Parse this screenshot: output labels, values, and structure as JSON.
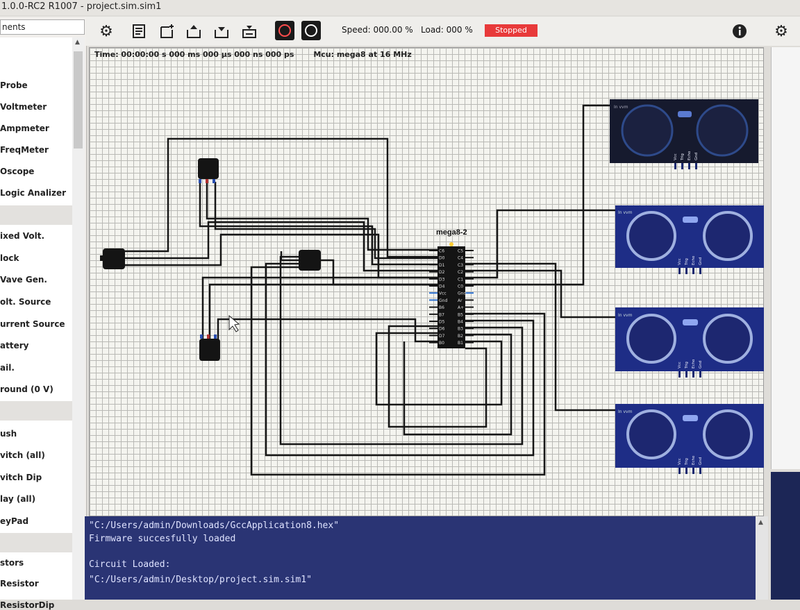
{
  "window": {
    "title": "1.0.0-RC2 R1007 - project.sim.sim1"
  },
  "sidebar": {
    "header": "nents",
    "items": [
      {
        "label": "Probe"
      },
      {
        "label": "Voltmeter"
      },
      {
        "label": "Ampmeter"
      },
      {
        "label": "FreqMeter"
      },
      {
        "label": "Oscope"
      },
      {
        "label": "Logic Analizer"
      },
      {
        "label": "ixed Volt."
      },
      {
        "label": "lock"
      },
      {
        "label": "Vave Gen."
      },
      {
        "label": "olt. Source"
      },
      {
        "label": "urrent Source"
      },
      {
        "label": "attery"
      },
      {
        "label": "ail."
      },
      {
        "label": "round (0 V)"
      },
      {
        "label": "ush"
      },
      {
        "label": "vitch (all)"
      },
      {
        "label": "vitch Dip"
      },
      {
        "label": "lay (all)"
      },
      {
        "label": "eyPad"
      },
      {
        "label": "stors"
      },
      {
        "label": "Resistor"
      },
      {
        "label": "ResistorDip"
      }
    ]
  },
  "toolbar": {
    "icons": [
      "gear-icon",
      "file-list-icon",
      "new-circuit-icon",
      "open-icon",
      "save-icon",
      "save-as-icon",
      "stop-icon",
      "pause-icon"
    ],
    "speed_label": "Speed: 000.00 %",
    "load_label": "Load: 000 %",
    "status": "Stopped",
    "status_color": "#e83a3a"
  },
  "canvas": {
    "time_label": "Time: 00:00:00 s  000 ms  000 µs  000 ns  000 ps",
    "mcu_label": "Mcu: mega8 at 16 MHz",
    "chip_name": "mega8-2",
    "chip_pins_left": [
      "C6",
      "D0",
      "D1",
      "D2",
      "D3",
      "D4",
      "Vcc",
      "Gnd",
      "B6",
      "B7",
      "D5",
      "D6",
      "D7",
      "B0"
    ],
    "chip_pins_right": [
      "C5",
      "C4",
      "C3",
      "C2",
      "C1",
      "C0",
      "Gnd",
      "Ar",
      "A+",
      "B5",
      "B4",
      "B3",
      "B2",
      "B1"
    ],
    "sensor_pins": [
      "Vcc",
      "Trig",
      "Echo",
      "Gnd"
    ],
    "sensor_header": "In vvm"
  },
  "console": {
    "lines": [
      "\"C:/Users/admin/Downloads/GccApplication8.hex\"",
      "Firmware succesfully loaded",
      "",
      "Circuit Loaded:",
      "\"C:/Users/admin/Desktop/project.sim.sim1\""
    ]
  },
  "colors": {
    "wire": "#161616",
    "sensor_body": "#1e2d86",
    "sensor_dark": "#161a2e",
    "console_bg": "#2a3474"
  }
}
